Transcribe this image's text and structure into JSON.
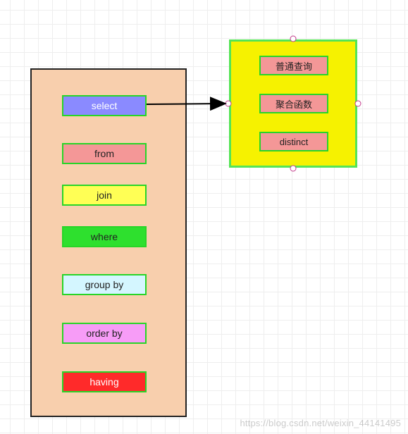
{
  "left_panel": {
    "items": [
      {
        "label": "select",
        "bg": "#8a8aff",
        "fg": "#ffffff"
      },
      {
        "label": "from",
        "bg": "#f49797",
        "fg": "#222222"
      },
      {
        "label": "join",
        "bg": "#ffff55",
        "fg": "#222222"
      },
      {
        "label": "where",
        "bg": "#2ee02e",
        "fg": "#222222"
      },
      {
        "label": "group by",
        "bg": "#d4f6ff",
        "fg": "#222222"
      },
      {
        "label": "order by",
        "bg": "#f79cf7",
        "fg": "#222222"
      },
      {
        "label": "having",
        "bg": "#ff2a2a",
        "fg": "#ffffff"
      }
    ]
  },
  "right_panel": {
    "items": [
      {
        "label": "普通查询"
      },
      {
        "label": "聚合函数"
      },
      {
        "label": "distinct"
      }
    ],
    "selected": true,
    "handles": [
      "top",
      "right",
      "bottom",
      "left"
    ]
  },
  "arrow": {
    "from": "select",
    "to": "right_panel"
  },
  "watermark": "https://blog.csdn.net/weixin_44141495"
}
